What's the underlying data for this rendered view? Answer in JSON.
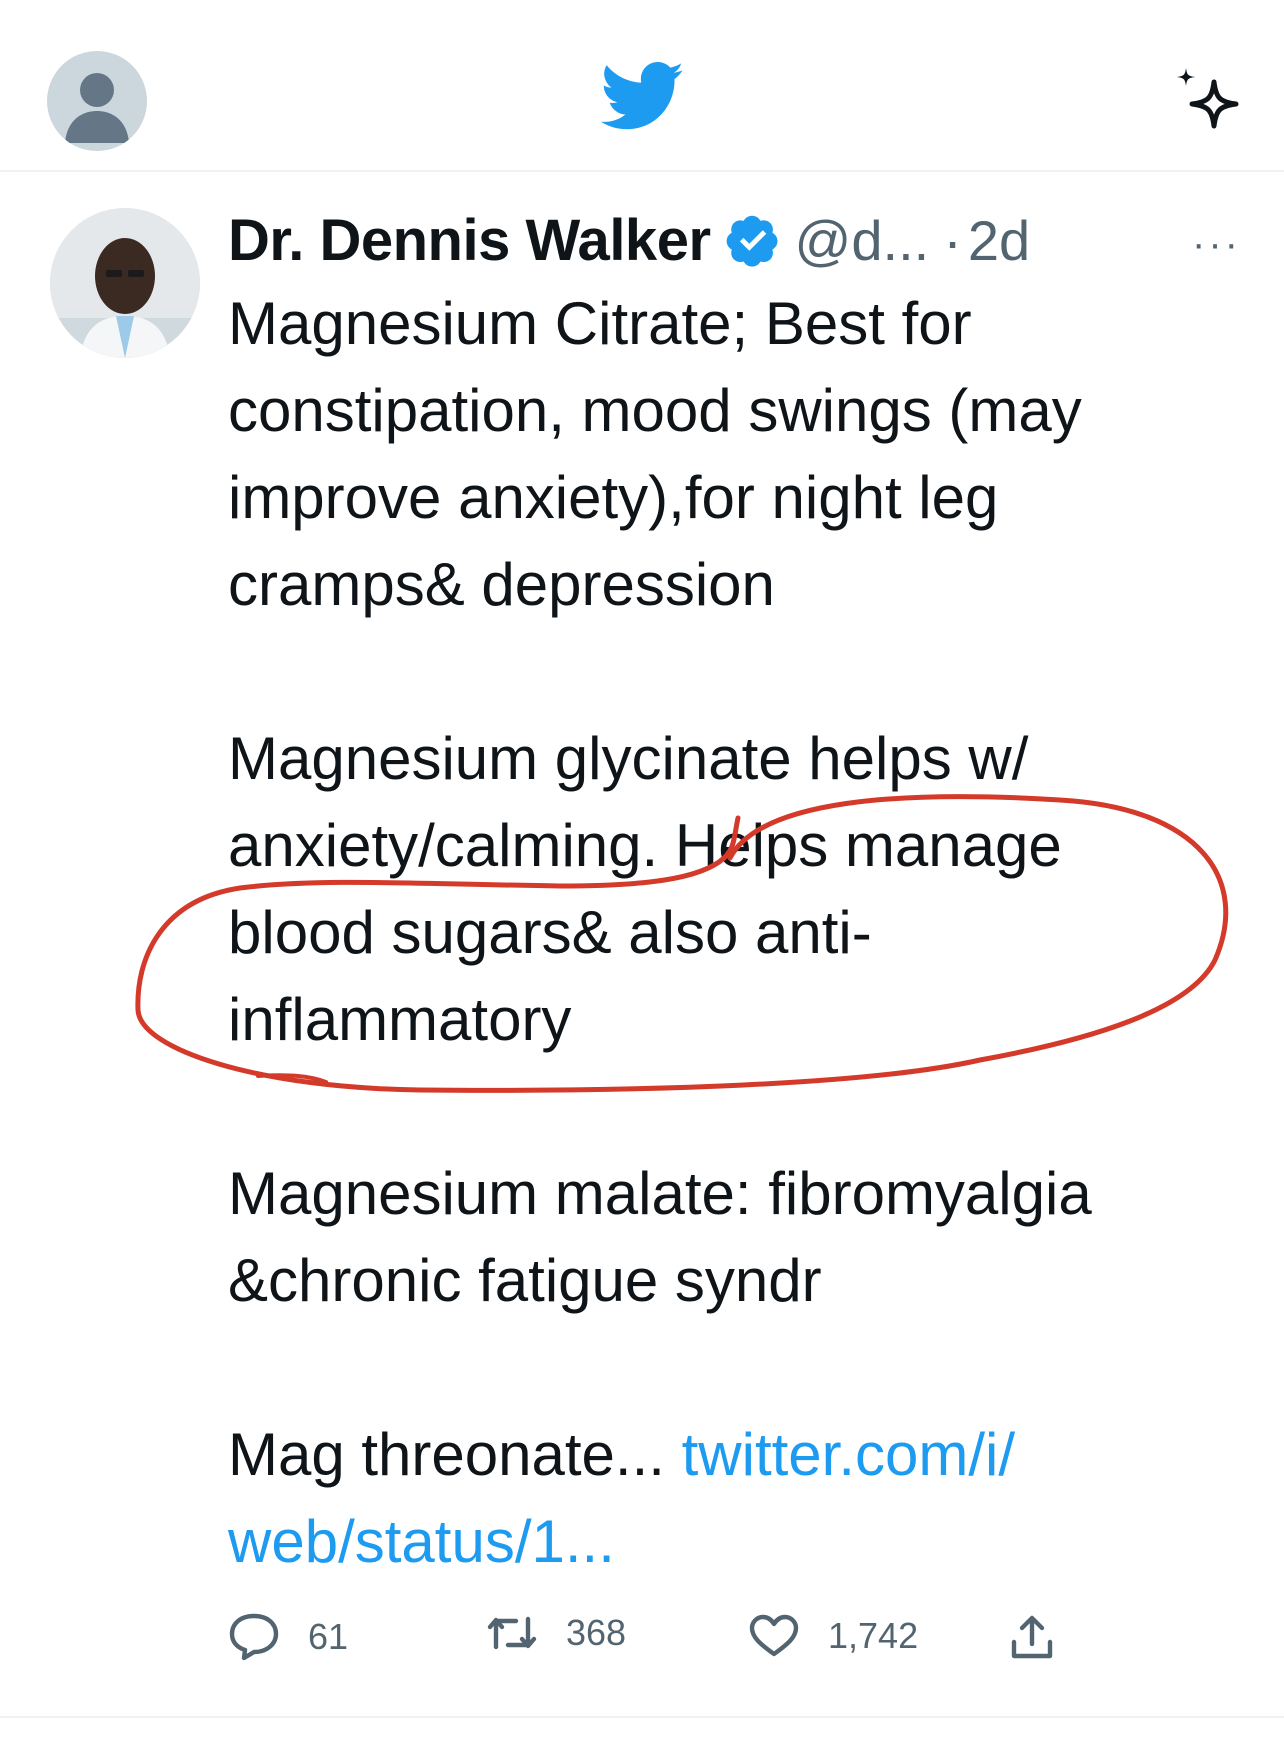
{
  "header_bar": {
    "account_avatar_icon": "default-profile-icon",
    "logo_icon": "twitter-bird-icon",
    "top_tweets_icon": "sparkle-icon",
    "brand_color": "#1d9bf0"
  },
  "tweet": {
    "author_name": "Dr. Dennis Walker",
    "verified_icon": "verified-badge-icon",
    "handle": "@d...",
    "time_separator": "·",
    "timestamp": "2d",
    "more_label": "···",
    "text": "Magnesium Citrate; Best for\nconstipation, mood swings (may\nimprove anxiety),for night leg\ncramps& depression\n\nMagnesium glycinate helps w/\nanxiety/calming. Helps manage\nblood sugars& also anti-\ninflammatory\n\nMagnesium malate: fibromyalgia\n&chronic fatigue syndr\n\nMag threonate... ",
    "link_text": "twitter.com/i/\nweb/status/1...",
    "link_color": "#1d9bf0",
    "annotation_color": "#d43a2a"
  },
  "actions": {
    "reply_icon": "reply-bubble-icon",
    "reply_count": "61",
    "retweet_icon": "retweet-icon",
    "retweet_count": "368",
    "like_icon": "heart-icon",
    "like_count": "1,742",
    "share_icon": "share-icon"
  }
}
